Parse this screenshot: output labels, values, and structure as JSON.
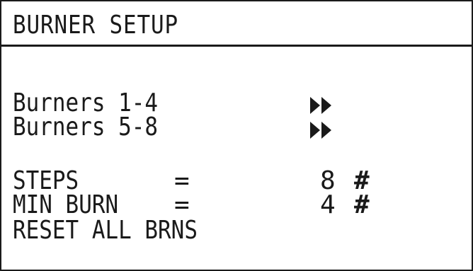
{
  "screen": {
    "title": "BURNER SETUP"
  },
  "menu": {
    "items": [
      {
        "label": "Burners 1-4",
        "icon": "double-arrow-right-icon"
      },
      {
        "label": "Burners 5-8",
        "icon": "double-arrow-right-icon"
      }
    ]
  },
  "params": {
    "steps": {
      "label": "STEPS",
      "equals": "=",
      "value": "8",
      "unit": "#"
    },
    "min_burn": {
      "label": "MIN BURN",
      "equals": "=",
      "value": "4",
      "unit": "#"
    },
    "reset": {
      "label": "RESET ALL BRNS"
    }
  },
  "colors": {
    "foreground": "#1a1a1a",
    "background": "#ffffff"
  }
}
